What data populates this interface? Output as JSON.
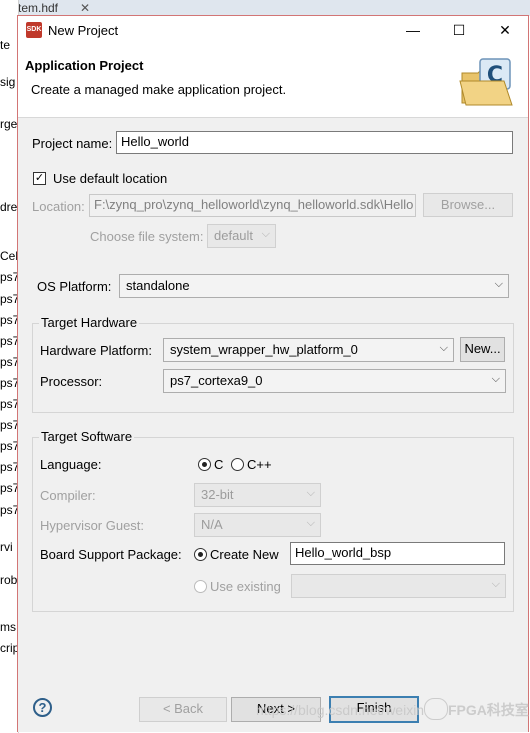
{
  "background_ide": {
    "tab_text": "system.hdf",
    "side_fragments": [
      "te",
      "sig",
      "rge",
      "dre",
      "Cel",
      "ps7",
      "ps7",
      "ps7",
      "ps7",
      "ps7",
      "ps7",
      "ps7",
      "ps7",
      "ps7",
      "ps7",
      "ps7",
      "ps7",
      "rvi",
      "rob",
      "ms",
      "crip"
    ]
  },
  "window": {
    "icon_text": "SDK",
    "title": "New Project",
    "minimize": "—",
    "maximize": "☐",
    "close": "✕"
  },
  "header": {
    "title": "Application Project",
    "subtitle": "Create a managed make application project."
  },
  "project": {
    "name_label": "Project name:",
    "name_value": "Hello_world",
    "use_default_label": "Use default location",
    "use_default_checked": true,
    "location_label": "Location:",
    "location_value": "F:\\zynq_pro\\zynq_helloworld\\zynq_helloworld.sdk\\Hello",
    "browse_label": "Browse...",
    "fs_label": "Choose file system:",
    "fs_value": "default"
  },
  "os": {
    "label": "OS Platform:",
    "value": "standalone"
  },
  "target_hardware": {
    "title": "Target Hardware",
    "platform_label": "Hardware Platform:",
    "platform_value": "system_wrapper_hw_platform_0",
    "new_label": "New...",
    "processor_label": "Processor:",
    "processor_value": "ps7_cortexa9_0"
  },
  "target_software": {
    "title": "Target Software",
    "language_label": "Language:",
    "lang_c": "C",
    "lang_cpp": "C++",
    "selected_language": "C",
    "compiler_label": "Compiler:",
    "compiler_value": "32-bit",
    "hypervisor_label": "Hypervisor Guest:",
    "hypervisor_value": "N/A",
    "bsp_label": "Board Support Package:",
    "create_new_label": "Create New",
    "bsp_value": "Hello_world_bsp",
    "use_existing_label": "Use existing"
  },
  "buttons": {
    "help": "?",
    "back": "< Back",
    "next": "Next >",
    "finish": "Finish"
  },
  "watermark": {
    "url_text": "https://blog.csdn.net/weixin",
    "brand": "FPGA科技室"
  }
}
